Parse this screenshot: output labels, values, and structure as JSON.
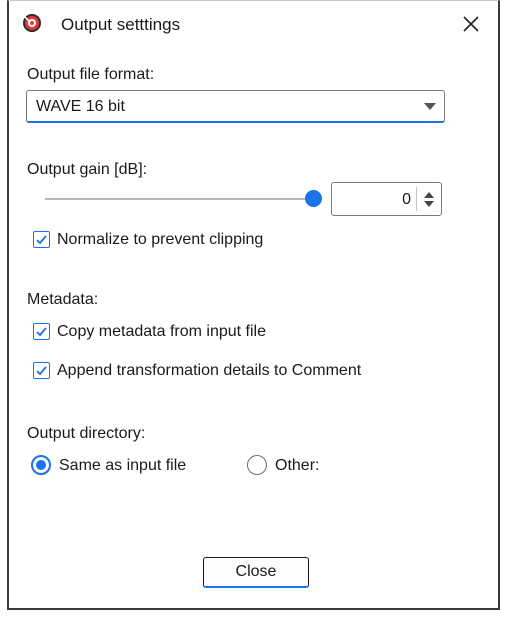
{
  "window": {
    "title": "Output setttings",
    "app_icon": "audio-app-icon",
    "close_icon": "close-icon"
  },
  "format": {
    "label": "Output file format:",
    "selected": "WAVE 16 bit"
  },
  "gain": {
    "label": "Output gain [dB]:",
    "value": "0",
    "slider_fraction": 1.0
  },
  "normalize": {
    "label": "Normalize to prevent clipping",
    "checked": true
  },
  "metadata": {
    "label": "Metadata:",
    "copy_label": "Copy metadata from input file",
    "copy_checked": true,
    "append_label": "Append transformation details to Comment",
    "append_checked": true
  },
  "directory": {
    "label": "Output directory:",
    "options": [
      "Same as input file",
      "Other:"
    ],
    "selected": "Same as input file"
  },
  "buttons": {
    "close_label": "Close"
  },
  "colors": {
    "accent": "#1a73e8"
  }
}
